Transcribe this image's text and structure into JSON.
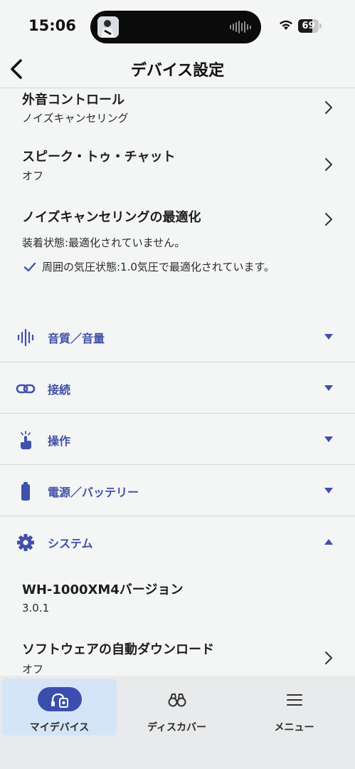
{
  "status_bar": {
    "time": "15:06",
    "battery_level": "69",
    "icons": [
      "wifi-icon",
      "battery-icon",
      "audio-waveform-icon"
    ]
  },
  "header": {
    "title": "デバイス設定",
    "back_icon": "chevron-left-icon"
  },
  "settings": [
    {
      "title": "外音コントロール",
      "value": "ノイズキャンセリング"
    },
    {
      "title": "スピーク・トゥ・チャット",
      "value": "オフ"
    },
    {
      "title": "ノイズキャンセリングの最適化",
      "value": "装着状態:最適化されていません。",
      "check_text": "周囲の気圧状態:1.0気圧で最適化されています。"
    }
  ],
  "sections": [
    {
      "label": "音質／音量",
      "icon": "sound-wave-icon",
      "expanded": false
    },
    {
      "label": "接続",
      "icon": "link-icon",
      "expanded": false
    },
    {
      "label": "操作",
      "icon": "touch-icon",
      "expanded": false
    },
    {
      "label": "電源／バッテリー",
      "icon": "battery-icon",
      "expanded": false
    },
    {
      "label": "システム",
      "icon": "gear-icon",
      "expanded": true
    }
  ],
  "system_items": [
    {
      "title": "WH-1000XM4バージョン",
      "value": "3.0.1"
    },
    {
      "title": "ソフトウェアの自動ダウンロード",
      "value": "オフ"
    }
  ],
  "bottom_nav": [
    {
      "label": "マイデバイス",
      "icon": "headphones-icon",
      "active": true
    },
    {
      "label": "ディスカバー",
      "icon": "binoculars-icon",
      "active": false
    },
    {
      "label": "メニュー",
      "icon": "hamburger-menu-icon",
      "active": false
    }
  ],
  "colors": {
    "accent": "#3f51a8",
    "background": "#f4f5f5",
    "nav_background": "#e9eaeb",
    "nav_active": "#d4e5f8",
    "divider": "#d6d8da"
  }
}
